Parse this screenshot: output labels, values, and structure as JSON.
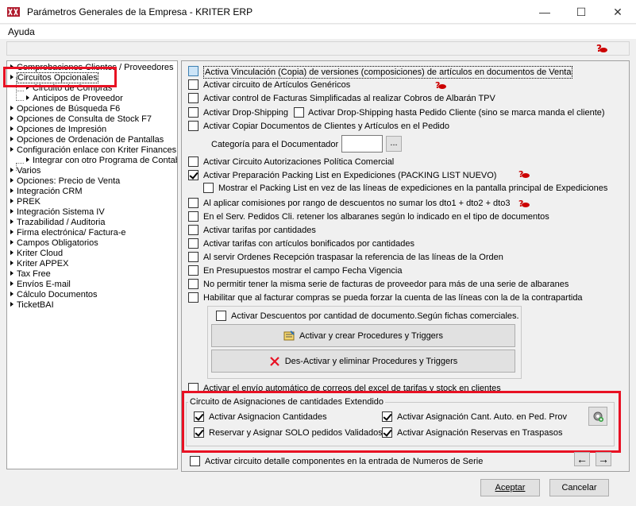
{
  "window": {
    "title": "Parámetros Generales de la Empresa - KRITER ERP",
    "minimize_glyph": "—",
    "maximize_glyph": "☐",
    "close_glyph": "✕"
  },
  "menu": {
    "ayuda": "Ayuda"
  },
  "tree": {
    "items": [
      "Comprobaciones Clientes / Proveedores",
      "Circuitos Opcionales",
      "Circuito de Compras",
      "Anticipos de Proveedor",
      "Opciones de Búsqueda F6",
      "Opciones de Consulta de Stock F7",
      "Opciones de Impresión",
      "Opciones de Ordenación de Pantallas",
      "Configuración enlace con Kriter Finances",
      "Integrar con otro Programa de Contabi",
      "Varios",
      "Opciones: Precio de Venta",
      "Integración CRM",
      "PREK",
      "Integración Sistema IV",
      "Trazabilidad / Auditoria",
      "Firma electrónica/ Factura-e",
      "Campos Obligatorios",
      "Kriter Cloud",
      "Kriter APPEX",
      "Tax Free",
      "Envíos E-mail",
      "Cálculo Documentos",
      "TicketBAI"
    ]
  },
  "options": {
    "o1": "Activa Vinculación (Copia) de versiones (composiciones) de artículos en documentos de Venta",
    "o2": "Activar circuito de Artículos Genéricos",
    "o3": "Activar control de Facturas Simplificadas al realizar Cobros de Albarán TPV",
    "o4a": "Activar Drop-Shipping",
    "o4b": "Activar Drop-Shipping hasta Pedido Cliente (sino se marca manda el cliente)",
    "o5": "Activar Copiar Documentos de Clientes y Artículos en el Pedido",
    "categoria_label": "Categoría para el Documentador",
    "categoria_value": "",
    "browse_label": "...",
    "o6": "Activar Circuito Autorizaciones Política Comercial",
    "o7": "Activar Preparación Packing List en Expediciones (PACKING LIST NUEVO)",
    "o8": "Mostrar el Packing List en vez de las líneas de expediciones en la pantalla principal de Expediciones",
    "o9": "Al aplicar comisiones por rango de descuentos no sumar los dto1 + dto2 + dto3",
    "o10": "En el Serv. Pedidos Cli. retener los albaranes según lo indicado en el tipo de documentos",
    "o11": "Activar tarifas por cantidades",
    "o12": "Activar tarifas con artículos bonificados por cantidades",
    "o13": "Al servir Ordenes Recepción traspasar la referencia de las líneas de la Orden",
    "o14": "En Presupuestos mostrar el campo Fecha Vigencia",
    "o15": "No permitir tener la misma serie de facturas de proveedor para más de una serie de albaranes",
    "o16": "Habilitar que al facturar compras se pueda forzar la cuenta de las líneas con la de la contrapartida",
    "o17": "Activar Descuentos por cantidad de documento.Según fichas comerciales.",
    "btn_activar": "Activar y crear Procedures y Triggers",
    "btn_desactivar": "Des-Activar y eliminar Procedures y Triggers",
    "o18": "Activar el envío automático de correos del excel de tarifas y stock en clientes",
    "group_title": "Circuito de Asignaciones de cantidades Extendido",
    "g1": "Activar Asignacion Cantidades",
    "g2": "Activar Asignación Cant. Auto. en Ped. Prov",
    "g3": "Reservar y Asignar SOLO pedidos Validados",
    "g4": "Activar Asignación Reservas en Traspasos",
    "o19": "Activar circuito detalle componentes en la entrada de Numeros de Serie"
  },
  "nav": {
    "prev": "←",
    "next": "→"
  },
  "dialog": {
    "aceptar": "Aceptar",
    "cancelar": "Cancelar"
  },
  "colors": {
    "highlight_red": "#e81123",
    "help_red": "#cc0000"
  }
}
